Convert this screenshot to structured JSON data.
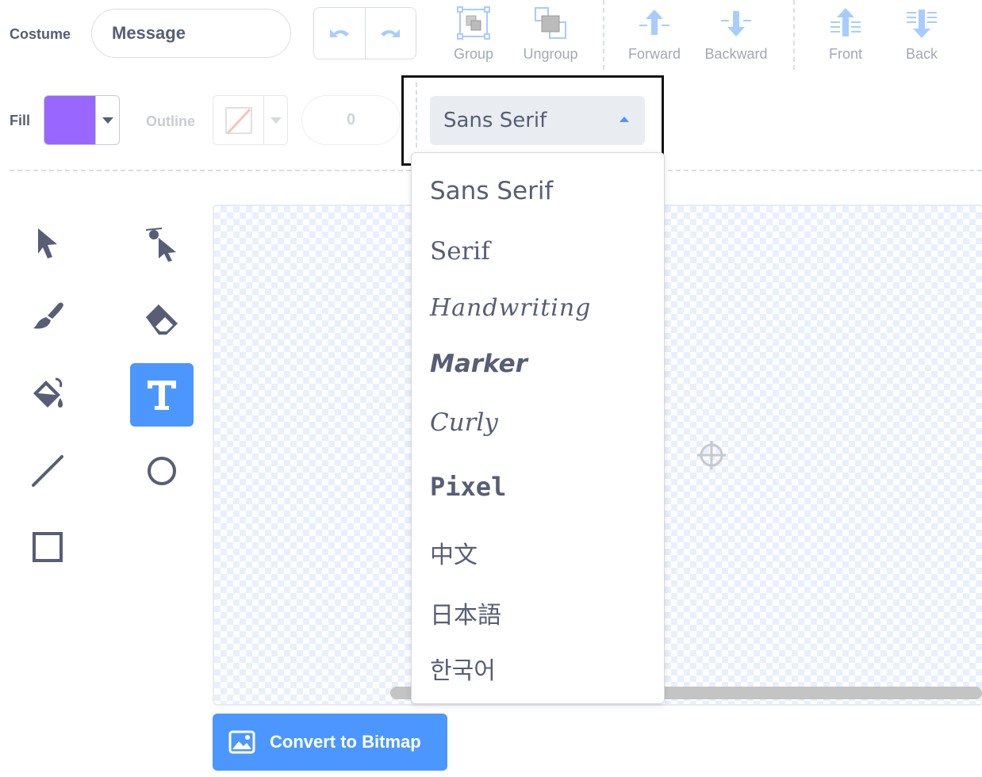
{
  "costume": {
    "label": "Costume",
    "name_value": "Message"
  },
  "toolbar": {
    "group": "Group",
    "ungroup": "Ungroup",
    "forward": "Forward",
    "backward": "Backward",
    "front": "Front",
    "back": "Back"
  },
  "fill": {
    "label": "Fill",
    "color": "#9966ff"
  },
  "outline": {
    "label": "Outline",
    "width_value": "0"
  },
  "font_select": {
    "selected": "Sans Serif",
    "options": [
      "Sans Serif",
      "Serif",
      "Handwriting",
      "Marker",
      "Curly",
      "Pixel",
      "中文",
      "日本語",
      "한국어"
    ]
  },
  "convert": {
    "label": "Convert to Bitmap"
  },
  "colors": {
    "accent": "#4c97ff",
    "icon_gray": "#575e75",
    "disabled": "#a3a8b4"
  }
}
